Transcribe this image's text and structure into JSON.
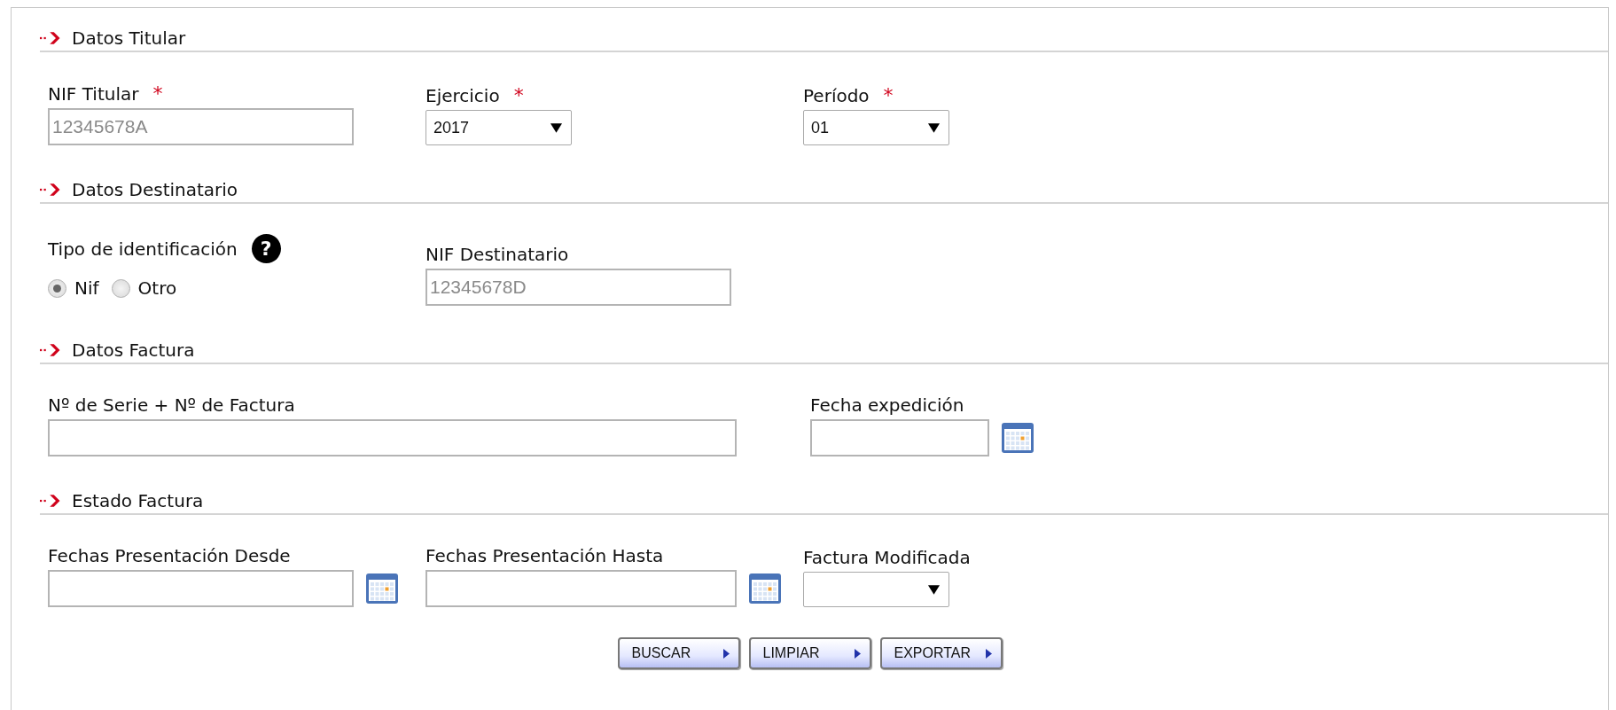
{
  "sections": [
    {
      "title": "Datos Titular",
      "fields": [
        {
          "kind": "text",
          "label": "NIF Titular",
          "required_mark": "*",
          "placeholder": "12345678A"
        },
        {
          "kind": "select",
          "label": "Ejercicio",
          "required_mark": "*",
          "value": "2017"
        },
        {
          "kind": "select",
          "label": "Período",
          "required_mark": "*",
          "value": "01"
        }
      ]
    },
    {
      "title": "Datos Destinatario",
      "fields": [
        {
          "kind": "radio",
          "label": "Tipo de identificación",
          "help": "?",
          "options": [
            {
              "label": "Nif",
              "selected": true
            },
            {
              "label": "Otro",
              "selected": false
            }
          ]
        },
        {
          "kind": "text",
          "label": "NIF Destinatario",
          "placeholder": "12345678D"
        }
      ]
    },
    {
      "title": "Datos Factura",
      "fields": [
        {
          "kind": "text",
          "label": "Nº de Serie + Nº de Factura"
        },
        {
          "kind": "date",
          "label": "Fecha expedición"
        }
      ]
    },
    {
      "title": "Estado Factura",
      "fields": [
        {
          "kind": "date",
          "label": "Fechas Presentación Desde"
        },
        {
          "kind": "date",
          "label": "Fechas Presentación Hasta"
        },
        {
          "kind": "select",
          "label": "Factura Modificada"
        }
      ]
    }
  ],
  "buttons": [
    {
      "label": "BUSCAR"
    },
    {
      "label": "LIMPIAR"
    },
    {
      "label": "EXPORTAR"
    }
  ]
}
